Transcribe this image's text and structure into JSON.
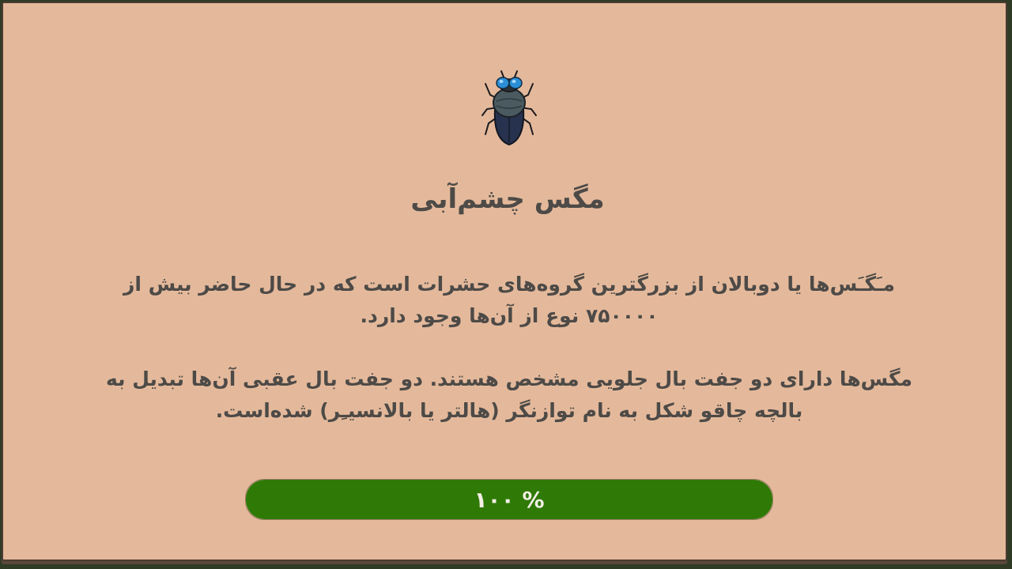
{
  "info_card": {
    "image_icon": "bluebottle-fly-icon",
    "title": "مگس چشم‌آبی",
    "paragraphs": [
      "مـَگـَس‌ها یا دوبالان  از بزرگترین گروه‌های حشرات است که در حال حاضر بیش از ۷۵۰۰۰۰ نوع از آن‌ها وجود دارد.",
      "مگس‌ها دارای دو جفت بال جلویی مشخص هستند. دو جفت بال عقبی آن‌ها تبدیل به بالچه چاقو شکل به نام توازنگر (هالتر یا بالانسیـِر) شده‌است."
    ]
  },
  "progress": {
    "value_percent": 100,
    "label": "% ۱۰۰"
  },
  "colors": {
    "panel_background": "#e4b99b",
    "panel_border": "#4a3b31",
    "text": "#4d4a47",
    "progress_fill": "#2f7a06",
    "progress_text": "#f3efe6"
  }
}
